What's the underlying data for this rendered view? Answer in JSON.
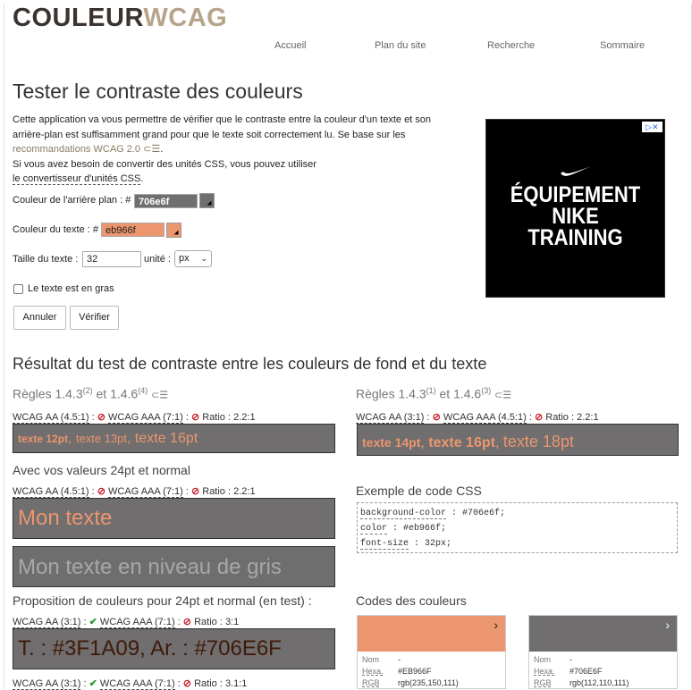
{
  "logo": {
    "part1": "COULEUR",
    "part2": "WCAG"
  },
  "nav": {
    "items": [
      "Accueil",
      "Plan du site",
      "Recherche",
      "Sommaire"
    ]
  },
  "page_title": "Tester le contraste des couleurs",
  "intro": {
    "line1": "Cette application va vous permettre de vérifier que le contraste entre la couleur d'un texte et son",
    "line2": "arrière-plan est suffisamment grand pour que le texte soit correctement lu. Se base sur les",
    "line3_link": "recommandations WCAG 2.0",
    "line4": "Si vous avez besoin de convertir des unités CSS, vous pouvez utiliser",
    "line5_link": "le convertisseur d'unités CSS",
    "line5_end": "."
  },
  "form": {
    "bg_label": "Couleur de l'arrière plan : #",
    "bg_value": "706e6f",
    "fg_label": "Couleur du texte : #",
    "fg_value": "eb966f",
    "size_label": "Taille du texte :",
    "size_value": "32",
    "unit_label": "unité :",
    "unit_value": "px",
    "bold_label": "Le texte est en gras",
    "cancel": "Annuler",
    "verify": "Vérifier"
  },
  "colors": {
    "bg": "#706e6f",
    "fg": "#eb966f"
  },
  "ad": {
    "line1": "ÉQUIPEMENT",
    "line2": "NIKE",
    "line3": "TRAINING"
  },
  "results_title": "Résultat du test de contraste entre les couleurs de fond et du texte",
  "left": {
    "rules": "Règles 1.4.3",
    "rules_sup1": "(2)",
    "rules_mid": " et 1.4.6",
    "rules_sup2": "(4)",
    "wcag_aa": "WCAG AA (4.5:1)",
    "wcag_aaa": "WCAG AAA (7:1)",
    "ratio_label": "Ratio",
    "ratio_value": "2.2:1",
    "demo_a": "texte 12pt",
    "demo_b": "texte 13pt",
    "demo_c": "texte 16pt",
    "custom_title": "Avec vos valeurs 24pt et normal",
    "custom_aa": "WCAG AA (4.5:1)",
    "custom_aaa": "WCAG AAA (7:1)",
    "custom_ratio": "2.2:1",
    "mon_texte": "Mon texte",
    "mon_texte_gris": "Mon texte en niveau de gris",
    "proposal_title": "Proposition de couleurs pour 24pt et normal (en test) :",
    "prop1_aa": "WCAG AA (3:1)",
    "prop1_aaa": "WCAG AAA (7:1)",
    "prop1_ratio": "3:1",
    "prop1_text": "T. : #3F1A09, Ar. : #706E6F",
    "prop2_aa": "WCAG AA (3:1)",
    "prop2_aaa": "WCAG AAA (7:1)",
    "prop2_ratio": "3.1:1"
  },
  "right": {
    "rules": "Règles 1.4.3",
    "rules_sup1": "(1)",
    "rules_mid": " et 1.4.6",
    "rules_sup2": "(3)",
    "wcag_aa": "WCAG AA (3:1)",
    "wcag_aaa": "WCAG AAA (4.5:1)",
    "ratio_label": "Ratio",
    "ratio_value": "2.2:1",
    "demo_a": "texte 14pt",
    "demo_b": "texte 16pt",
    "demo_c": "texte 18pt",
    "css_title": "Exemple de code CSS",
    "css_l1k": "background-color",
    "css_l1v": " : #706e6f;",
    "css_l2k": "color",
    "css_l2v": " : #eb966f;",
    "css_l3k": "font-size",
    "css_l3v": " : 32px;",
    "codes_title": "Codes des couleurs",
    "card1": {
      "nom_k": "Nom",
      "nom_v": "-",
      "hex_k": "Hexa.",
      "hex_v": "#EB966F",
      "rgb_k": "RGB",
      "rgb_v": "rgb(235,150,111)"
    },
    "card2": {
      "nom_k": "Nom",
      "nom_v": "-",
      "hex_k": "Hexa.",
      "hex_v": "#706E6F",
      "rgb_k": "RGB",
      "rgb_v": "rgb(112,110,111)"
    }
  }
}
